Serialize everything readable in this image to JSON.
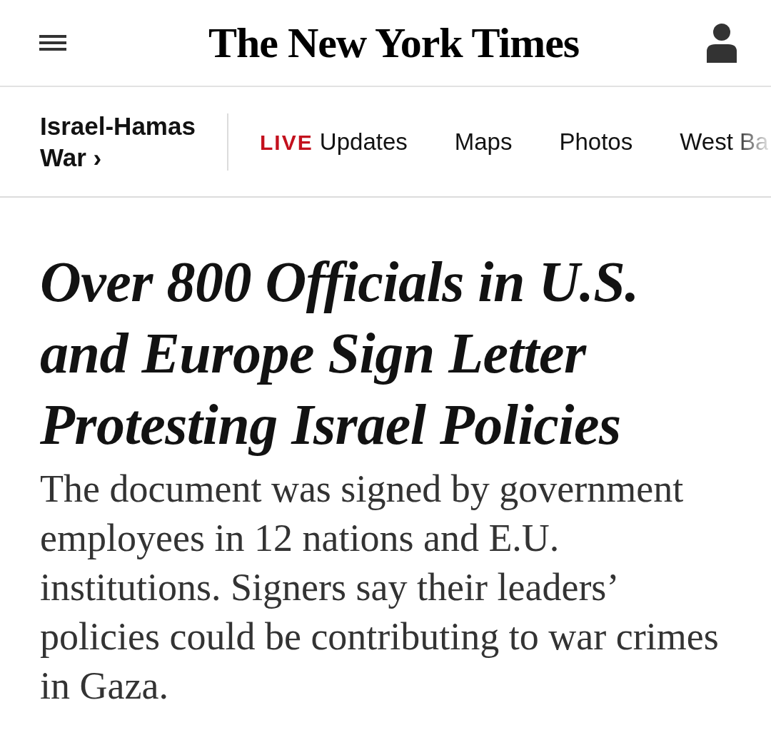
{
  "header": {
    "logo": "The New York Times"
  },
  "section_nav": {
    "section": "Israel-Hamas War ›",
    "items": [
      {
        "badge": "LIVE",
        "label": "Updates"
      },
      {
        "label": "Maps"
      },
      {
        "label": "Photos"
      },
      {
        "label": "West Ba",
        "faded": true
      }
    ]
  },
  "article": {
    "headline": "Over 800 Officials in U.S. and Europe Sign Letter Protesting Israel Policies",
    "summary": "The document was signed by government employees in 12 nations and E.U. institutions. Signers say their leaders’ policies could be contributing to war crimes in Gaza."
  }
}
